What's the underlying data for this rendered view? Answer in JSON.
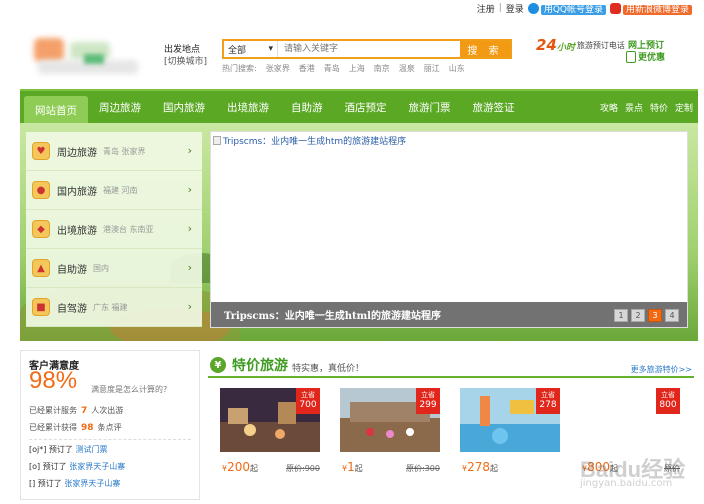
{
  "topbar": {
    "register": "注册",
    "login": "登录",
    "qq_login": "用QQ帐号登录",
    "weibo_login": "用新浪微博登录",
    "separator": "|"
  },
  "depart": {
    "label": "出发地点",
    "switch": "[切换城市]"
  },
  "search": {
    "category": "全部",
    "placeholder": "请输入关键字",
    "button": "搜 索",
    "hot_label": "热门搜索:",
    "hot_keywords": [
      "张家界",
      "香港",
      "青岛",
      "上海",
      "南京",
      "温泉",
      "丽江",
      "山东"
    ]
  },
  "hotline": {
    "num": "24",
    "unit": "小时",
    "text": "旅游预订电话"
  },
  "promo": {
    "line1": "网上预订",
    "line2": "更优惠",
    "big": "惠"
  },
  "nav": {
    "items": [
      "网站首页",
      "周边旅游",
      "国内旅游",
      "出境旅游",
      "自助游",
      "酒店预定",
      "旅游门票",
      "旅游签证"
    ],
    "right": [
      "攻略",
      "景点",
      "特价",
      "定制"
    ]
  },
  "categories": [
    {
      "name": "周边旅游",
      "sub": "青岛 张家界"
    },
    {
      "name": "国内旅游",
      "sub": "福建 河南"
    },
    {
      "name": "出境旅游",
      "sub": "港澳台 东南亚"
    },
    {
      "name": "自助游",
      "sub": "国内"
    },
    {
      "name": "自驾游",
      "sub": "广东 福建"
    }
  ],
  "slide": {
    "alt": "Tripscms：业内唯一生成htm的旅游建站程序",
    "caption": "Tripscms：业内唯一生成html的旅游建站程序",
    "pages": [
      "1",
      "2",
      "3",
      "4"
    ],
    "active_page": 3
  },
  "satisfaction": {
    "title": "客户满意度",
    "percent": "98%",
    "question": "满意度是怎么计算的?",
    "served_pre": "已经累计服务",
    "served_num": "7",
    "served_post": "人次出游",
    "reviews_pre": "已经累计获得",
    "reviews_num": "98",
    "reviews_post": "条点评",
    "bookings": [
      {
        "who": "[oj*]",
        "verb": "预订了",
        "item": "测试门票"
      },
      {
        "who": "[o]",
        "verb": "预订了",
        "item": "张家界天子山寨"
      },
      {
        "who": "[]",
        "verb": "预订了",
        "item": "张家界天子山寨"
      }
    ]
  },
  "deals": {
    "title": "特价旅游",
    "slogan": "特实惠，真低价！",
    "more": "更多旅游特价>>",
    "cards": [
      {
        "tag_top": "立省",
        "tag_val": "700",
        "currency": "¥",
        "price": "200",
        "suffix": "起",
        "orig_label": "原价:",
        "orig": "900"
      },
      {
        "tag_top": "立省",
        "tag_val": "299",
        "currency": "¥",
        "price": "1",
        "suffix": "起",
        "orig_label": "原价:",
        "orig": "300"
      },
      {
        "tag_top": "立省",
        "tag_val": "278",
        "currency": "¥",
        "price": "278",
        "suffix": "起",
        "orig_label": "",
        "orig": ""
      },
      {
        "tag_top": "立省",
        "tag_val": "800",
        "currency": "¥",
        "price": "800",
        "suffix": "起",
        "orig_label": "原价",
        "orig": ""
      }
    ]
  },
  "watermark": {
    "brand": "Baidu经验",
    "url": "jingyan.baidu.com"
  },
  "colors": {
    "brand_green": "#5ba825",
    "accent_orange": "#f06b14",
    "search_orange": "#f29a14",
    "sale_red": "#e1261c"
  }
}
